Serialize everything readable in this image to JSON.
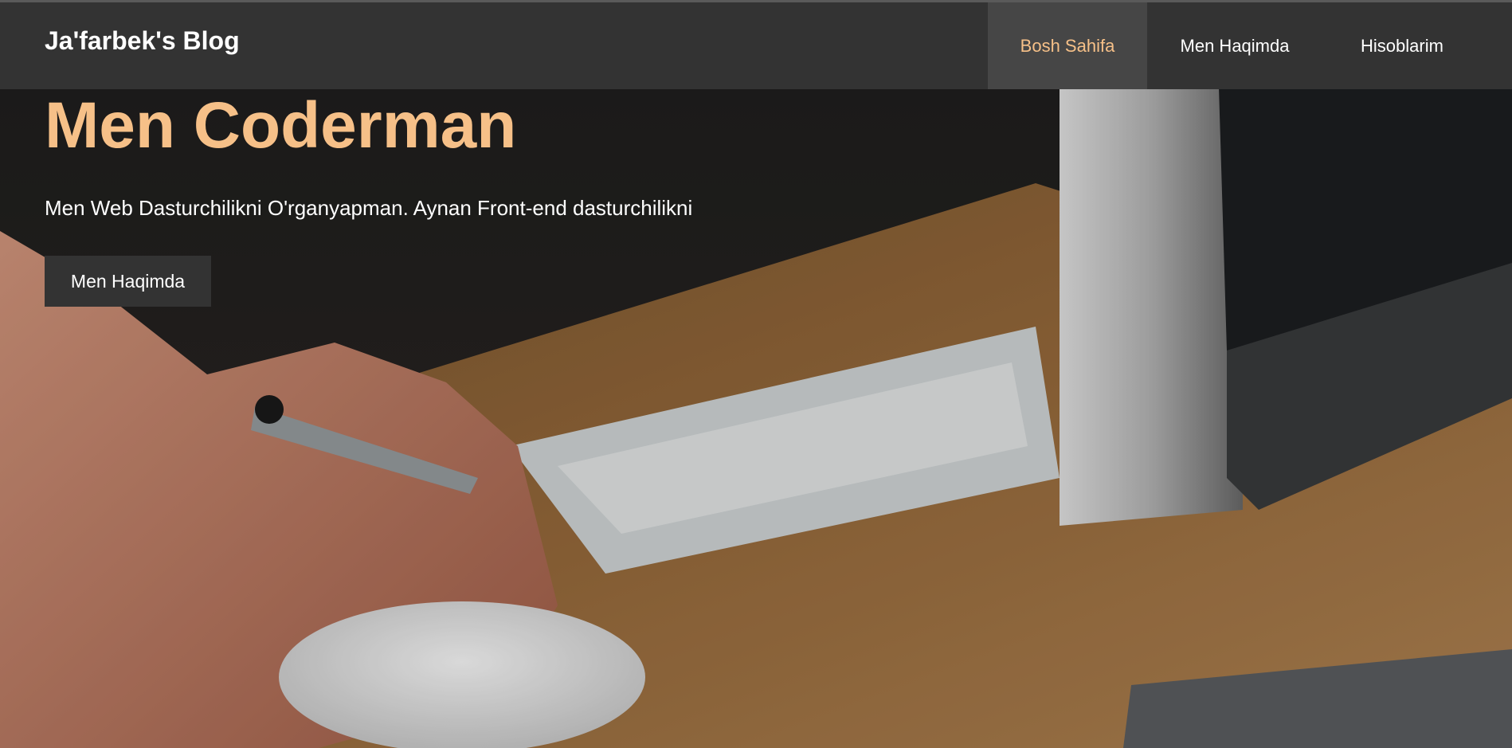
{
  "brand": {
    "title": "Ja'farbek's Blog"
  },
  "nav": {
    "items": [
      {
        "label": "Bosh Sahifa",
        "active": true
      },
      {
        "label": "Men Haqimda",
        "active": false
      },
      {
        "label": "Hisoblarim",
        "active": false
      }
    ]
  },
  "hero": {
    "title": "Men Coderman",
    "subtitle": "Men Web Dasturchilikni O'rganyapman. Aynan Front-end dasturchilikni",
    "button_label": "Men Haqimda"
  },
  "colors": {
    "accent": "#f6c088",
    "topbar": "#333333",
    "active_tab": "#464646"
  }
}
